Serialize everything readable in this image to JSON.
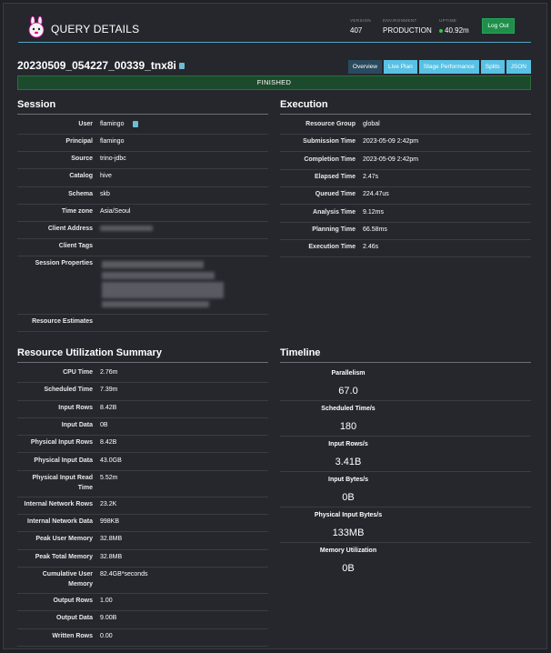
{
  "header": {
    "title": "QUERY DETAILS",
    "version_label": "VERSION",
    "version": "407",
    "environment_label": "ENVIRONMENT",
    "environment": "PRODUCTION",
    "uptime_label": "UPTIME",
    "uptime": "40.92m",
    "logout": "Log Out"
  },
  "query": {
    "id": "20230509_054227_00339_tnx8i",
    "state": "FINISHED"
  },
  "tabs": [
    "Overview",
    "Live Plan",
    "Stage Performance",
    "Splits",
    "JSON"
  ],
  "session": {
    "title": "Session",
    "rows": [
      {
        "k": "User",
        "v": "flamingo"
      },
      {
        "k": "Principal",
        "v": "flamingo"
      },
      {
        "k": "Source",
        "v": "trino-jdbc"
      },
      {
        "k": "Catalog",
        "v": "hive"
      },
      {
        "k": "Schema",
        "v": "skb"
      },
      {
        "k": "Time zone",
        "v": "Asia/Seoul"
      },
      {
        "k": "Client Address",
        "v": ""
      },
      {
        "k": "Client Tags",
        "v": ""
      },
      {
        "k": "Session Properties",
        "v": ""
      },
      {
        "k": "Resource Estimates",
        "v": ""
      }
    ]
  },
  "execution": {
    "title": "Execution",
    "rows": [
      {
        "k": "Resource Group",
        "v": "global"
      },
      {
        "k": "Submission Time",
        "v": "2023-05-09 2:42pm"
      },
      {
        "k": "Completion Time",
        "v": "2023-05-09 2:42pm"
      },
      {
        "k": "Elapsed Time",
        "v": "2.47s"
      },
      {
        "k": "Queued Time",
        "v": "224.47us"
      },
      {
        "k": "Analysis Time",
        "v": "9.12ms"
      },
      {
        "k": "Planning Time",
        "v": "66.58ms"
      },
      {
        "k": "Execution Time",
        "v": "2.46s"
      }
    ]
  },
  "resources": {
    "title": "Resource Utilization Summary",
    "rows": [
      {
        "k": "CPU Time",
        "v": "2.76m"
      },
      {
        "k": "Scheduled Time",
        "v": "7.39m"
      },
      {
        "k": "Input Rows",
        "v": "8.42B"
      },
      {
        "k": "Input Data",
        "v": "0B"
      },
      {
        "k": "Physical Input Rows",
        "v": "8.42B"
      },
      {
        "k": "Physical Input Data",
        "v": "43.0GB"
      },
      {
        "k": "Physical Input Read",
        "k2": "Time",
        "v": "5.52m"
      },
      {
        "k": "Internal Network Rows",
        "v": "23.2K"
      },
      {
        "k": "Internal Network Data",
        "v": "998KB"
      },
      {
        "k": "Peak User Memory",
        "v": "32.8MB"
      },
      {
        "k": "Peak Total Memory",
        "v": "32.8MB"
      },
      {
        "k": "Cumulative User",
        "k2": "Memory",
        "v": "82.4GB*seconds"
      },
      {
        "k": "Output Rows",
        "v": "1.00"
      },
      {
        "k": "Output Data",
        "v": "9.00B"
      },
      {
        "k": "Written Rows",
        "v": "0.00"
      }
    ]
  },
  "timeline": {
    "title": "Timeline",
    "rows": [
      {
        "k": "Parallelism",
        "v": "67.0"
      },
      {
        "k": "Scheduled Time/s",
        "v": "180"
      },
      {
        "k": "Input Rows/s",
        "v": "3.41B"
      },
      {
        "k": "Input Bytes/s",
        "v": "0B"
      },
      {
        "k": "Physical Input Bytes/s",
        "v": "133MB"
      },
      {
        "k": "Memory Utilization",
        "v": "0B"
      }
    ]
  },
  "colors": {
    "accent": "#59c1e3",
    "finished": "#1c4a2c",
    "logout": "#1e8f4a"
  }
}
